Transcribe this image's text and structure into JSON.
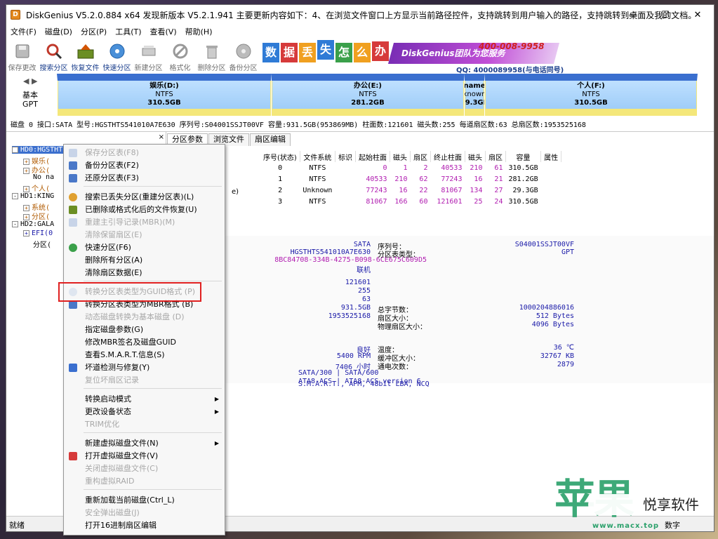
{
  "window": {
    "title": "DiskGenius V5.2.0.884 x64   发现新版本 V5.2.1.941 主要更新内容如下：4、在浏览文件窗口上方显示当前路径控件，支持跳转到用户输入的路径，支持跳转到桌面及我的文档。",
    "controls": {
      "minimize": "—",
      "maximize": "☐",
      "close": "✕"
    }
  },
  "menubar": [
    "文件(F)",
    "磁盘(D)",
    "分区(P)",
    "工具(T)",
    "查看(V)",
    "帮助(H)"
  ],
  "toolbar": [
    {
      "label": "保存更改",
      "icon": "save-icon",
      "enabled": false
    },
    {
      "label": "搜索分区",
      "icon": "search-icon",
      "enabled": true
    },
    {
      "label": "恢复文件",
      "icon": "recover-icon",
      "enabled": true
    },
    {
      "label": "快速分区",
      "icon": "quick-partition-icon",
      "enabled": true
    },
    {
      "label": "新建分区",
      "icon": "new-partition-icon",
      "enabled": false
    },
    {
      "label": "格式化",
      "icon": "format-icon",
      "enabled": false
    },
    {
      "label": "删除分区",
      "icon": "delete-icon",
      "enabled": false
    },
    {
      "label": "备份分区",
      "icon": "backup-icon",
      "enabled": false
    }
  ],
  "banner": {
    "chars": [
      "数",
      "据",
      "丢",
      "失",
      "怎",
      "么",
      "办"
    ],
    "strip_text": "DiskGenius团队为您服务",
    "phone": "400-008-9958",
    "qq": "QQ: 4000089958(与电话同号)"
  },
  "partmap": {
    "nav": "◀ ▶",
    "disk_type": [
      "基本",
      "GPT"
    ],
    "partitions": [
      {
        "name": "娱乐(D:)",
        "fs": "NTFS",
        "size": "310.5GB"
      },
      {
        "name": "办公(E:)",
        "fs": "NTFS",
        "size": "281.2GB"
      },
      {
        "name": "name",
        "fs": "known",
        "size": "29.3GB"
      },
      {
        "name": "个人(F:)",
        "fs": "NTFS",
        "size": "310.5GB"
      }
    ]
  },
  "diskinfo": "磁盘 0 接口:SATA  型号:HGSTHTS541010A7E630  序列号:S04001SSJT00VF  容量:931.5GB(953869MB)  柱面数:121601  磁头数:255  每道扇区数:63  总扇区数:1953525168",
  "tree": {
    "close": "×",
    "rows": [
      {
        "text": "HD0:HGSTHTS541010A7E630(932GB)",
        "color": "#ffffff",
        "selected": true
      },
      {
        "text": "娱乐(",
        "color": "#b05a00"
      },
      {
        "text": "办公(",
        "color": "#b05a00"
      },
      {
        "text": "No na",
        "color": "#000000"
      },
      {
        "text": "个人(",
        "color": "#b05a00"
      },
      {
        "text": "HD1:KING",
        "color": "#000000"
      },
      {
        "text": "系统(",
        "color": "#b05a00"
      },
      {
        "text": "分区(",
        "color": "#b05a00"
      },
      {
        "text": "HD2:GALA",
        "color": "#000000"
      },
      {
        "text": "EFI(0",
        "color": "#1a1aa8"
      },
      {
        "text": "分区(",
        "color": "#000000"
      }
    ]
  },
  "tabs": [
    "分区参数",
    "浏览文件",
    "扇区编辑"
  ],
  "ptable": {
    "headers": [
      "序号(状态)",
      "文件系统",
      "标识",
      "起始柱面",
      "磁头",
      "扇区",
      "终止柱面",
      "磁头",
      "扇区",
      "容量",
      "属性"
    ],
    "row_prefix": [
      "",
      "",
      "e)",
      ""
    ],
    "rows": [
      [
        "0",
        "NTFS",
        "",
        "0",
        "1",
        "2",
        "40533",
        "210",
        "61",
        "310.5GB",
        ""
      ],
      [
        "1",
        "NTFS",
        "",
        "40533",
        "210",
        "62",
        "77243",
        "16",
        "21",
        "281.2GB",
        ""
      ],
      [
        "2",
        "Unknown",
        "",
        "77243",
        "16",
        "22",
        "81067",
        "134",
        "27",
        "29.3GB",
        ""
      ],
      [
        "3",
        "NTFS",
        "",
        "81067",
        "166",
        "60",
        "121601",
        "25",
        "24",
        "310.5GB",
        ""
      ]
    ]
  },
  "info": {
    "interface": "SATA",
    "model": "HGSTHTS541010A7E630",
    "guid": "8BC84708-334B-4275-B098-6CE675C609D5",
    "status": "联机",
    "serial_label": "序列号：",
    "serial": "S04001SSJT00VF",
    "ptype_label": "分区表类型：",
    "ptype": "GPT",
    "cylinders": "121601",
    "heads": "255",
    "sectors": "63",
    "capacity": "931.5GB",
    "total_sectors": "1953525168",
    "total_bytes_label": "总字节数：",
    "total_bytes": "1000204886016",
    "sector_size_label": "扇区大小：",
    "sector_size": "512 Bytes",
    "phys_sector_label": "物理扇区大小：",
    "phys_sector": "4096 Bytes",
    "health": "良好",
    "rpm": "5400 RPM",
    "hours": "7406 小时",
    "sata": "SATA/300 | SATA/600",
    "ata": "ATA8-ACS | ATA8-ACS version 6",
    "features": "S.M.A.R.T., APM, 48bit LBA, NCQ",
    "temp_label": "温度：",
    "temp": "36 ℃",
    "cache_label": "缓冲区大小：",
    "cache": "32767 KB",
    "power_label": "通电次数：",
    "power": "2879"
  },
  "context_menu": [
    {
      "label": "保存分区表(F8)",
      "enabled": false,
      "icon": "save-icon"
    },
    {
      "label": "备份分区表(F2)",
      "enabled": true,
      "icon": "backup-table-icon"
    },
    {
      "label": "还原分区表(F3)",
      "enabled": true,
      "icon": "restore-table-icon"
    },
    {
      "sep": true
    },
    {
      "label": "搜索已丢失分区(重建分区表)(L)",
      "enabled": true,
      "icon": "search-lost-icon"
    },
    {
      "label": "已删除或格式化后的文件恢复(U)",
      "enabled": true,
      "icon": "recover-icon"
    },
    {
      "label": "重建主引导记录(MBR)(M)",
      "enabled": false,
      "icon": "rebuild-mbr-icon"
    },
    {
      "label": "清除保留扇区(E)",
      "enabled": false
    },
    {
      "label": "快速分区(F6)",
      "enabled": true,
      "icon": "quick-partition-icon"
    },
    {
      "label": "删除所有分区(A)",
      "enabled": true
    },
    {
      "label": "清除扇区数据(E)",
      "enabled": true
    },
    {
      "sep": true
    },
    {
      "label": "转换分区表类型为GUID格式 (P)",
      "enabled": false,
      "icon": "convert-guid-icon"
    },
    {
      "label": "转换分区表类型为MBR格式 (B)",
      "enabled": true,
      "icon": "convert-mbr-icon"
    },
    {
      "label": "动态磁盘转换为基本磁盘 (D)",
      "enabled": false
    },
    {
      "label": "指定磁盘参数(G)",
      "enabled": true
    },
    {
      "label": "修改MBR签名及磁盘GUID",
      "enabled": true
    },
    {
      "label": "查看S.M.A.R.T.信息(S)",
      "enabled": true
    },
    {
      "label": "坏道检测与修复(Y)",
      "enabled": true,
      "icon": "repair-tools-icon"
    },
    {
      "label": "复位坏扇区记录",
      "enabled": false
    },
    {
      "sep": true
    },
    {
      "label": "转换启动模式",
      "enabled": true,
      "submenu": true
    },
    {
      "label": "更改设备状态",
      "enabled": true,
      "submenu": true
    },
    {
      "label": "TRIM优化",
      "enabled": false
    },
    {
      "sep": true
    },
    {
      "label": "新建虚拟磁盘文件(N)",
      "enabled": true,
      "submenu": true
    },
    {
      "label": "打开虚拟磁盘文件(V)",
      "enabled": true,
      "icon": "open-vdisk-icon"
    },
    {
      "label": "关闭虚拟磁盘文件(C)",
      "enabled": false
    },
    {
      "label": "重构虚拟RAID",
      "enabled": false
    },
    {
      "sep": true
    },
    {
      "label": "重新加载当前磁盘(Ctrl_L)",
      "enabled": true
    },
    {
      "label": "安全弹出磁盘(J)",
      "enabled": false
    },
    {
      "label": "打开16进制扇区编辑",
      "enabled": true
    }
  ],
  "statusbar": {
    "left": "就绪",
    "right": "数字"
  },
  "watermark": {
    "big": "苹果",
    "pill": "悦享软件",
    "url": "www.macx.top"
  },
  "colors": {
    "accent_blue": "#3b6fce",
    "disabled_gray": "#a8a8a8",
    "highlight_red": "#e02020",
    "partition_fill": "#bfe0ff",
    "partition_border": "#f4e77a"
  }
}
